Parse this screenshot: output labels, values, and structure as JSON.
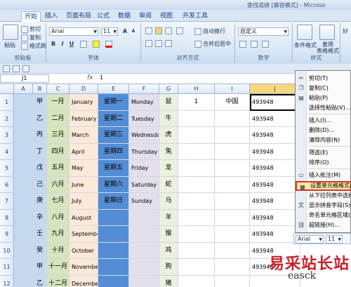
{
  "window": {
    "title": "查找成绩 [兼容模式] - Microso"
  },
  "tabs": [
    "开始",
    "插入",
    "页面布局",
    "公式",
    "数据",
    "审阅",
    "视图",
    "开发工具"
  ],
  "ribbon": {
    "clipboard": {
      "paste": "粘贴",
      "cut": "剪切",
      "copy": "复制",
      "format_painter": "格式刷",
      "label": "剪贴板"
    },
    "font": {
      "name": "Arial",
      "size": "11",
      "bold": "B",
      "italic": "I",
      "underline": "U",
      "grow": "A",
      "shrink": "A",
      "label": "字体"
    },
    "alignment": {
      "wrap": "自动换行",
      "merge": "合并后居中",
      "label": "对齐方式"
    },
    "number": {
      "format": "自定义",
      "label": "数字"
    },
    "styles": {
      "conditional": "条件格式",
      "table": "套用\n表格格式",
      "label": "样式"
    },
    "more": {
      "text": "好"
    }
  },
  "formula_bar": {
    "name_box": "J1",
    "fx": "fx",
    "value": "1"
  },
  "columns": [
    "A",
    "B",
    "C",
    "D",
    "E",
    "F",
    "G",
    "H",
    "I",
    "J"
  ],
  "rows": [
    {
      "num": "1",
      "b": "甲",
      "c": "一月",
      "d": "January",
      "e": "星期一",
      "f": "Monday",
      "g": "鼠",
      "h": "1",
      "i": "中国",
      "j": "493948"
    },
    {
      "num": "2",
      "b": "乙",
      "c": "二月",
      "d": "February",
      "e": "星期二",
      "f": "Tuesday",
      "g": "牛",
      "h": "",
      "i": "",
      "j": "493948"
    },
    {
      "num": "3",
      "b": "丙",
      "c": "三月",
      "d": "March",
      "e": "星期三",
      "f": "Wednesday",
      "g": "虎",
      "h": "",
      "i": "",
      "j": "493948"
    },
    {
      "num": "4",
      "b": "丁",
      "c": "四月",
      "d": "April",
      "e": "星期四",
      "f": "Thursday",
      "g": "兔",
      "h": "",
      "i": "",
      "j": "493948"
    },
    {
      "num": "5",
      "b": "戊",
      "c": "五月",
      "d": "May",
      "e": "星期五",
      "f": "Friday",
      "g": "龙",
      "h": "",
      "i": "",
      "j": "493948"
    },
    {
      "num": "6",
      "b": "己",
      "c": "六月",
      "d": "June",
      "e": "星期六",
      "f": "Saturday",
      "g": "蛇",
      "h": "",
      "i": "",
      "j": "493948"
    },
    {
      "num": "7",
      "b": "庚",
      "c": "七月",
      "d": "July",
      "e": "星期日",
      "f": "Sunday",
      "g": "马",
      "h": "",
      "i": "",
      "j": "493948"
    },
    {
      "num": "8",
      "b": "辛",
      "c": "八月",
      "d": "August",
      "e": "",
      "f": "",
      "g": "羊",
      "h": "",
      "i": "",
      "j": "493948"
    },
    {
      "num": "9",
      "b": "壬",
      "c": "九月",
      "d": "September",
      "e": "",
      "f": "",
      "g": "猴",
      "h": "",
      "i": "",
      "j": "493948"
    },
    {
      "num": "10",
      "b": "癸",
      "c": "十月",
      "d": "October",
      "e": "",
      "f": "",
      "g": "鸡",
      "h": "",
      "i": "",
      "j": "493948"
    },
    {
      "num": "11",
      "b": "甲",
      "c": "十一月",
      "d": "November",
      "e": "",
      "f": "",
      "g": "狗",
      "h": "",
      "i": "",
      "j": "493948"
    },
    {
      "num": "12",
      "b": "乙",
      "c": "十二月",
      "d": "December",
      "e": "",
      "f": "",
      "g": "猪",
      "h": "",
      "i": "",
      "j": ""
    }
  ],
  "context_menu": [
    {
      "label": "剪切(T)",
      "icon": "scissors-icon"
    },
    {
      "label": "复制(C)",
      "icon": "copy-icon"
    },
    {
      "label": "粘贴(P)",
      "icon": "paste-icon"
    },
    {
      "label": "选择性粘贴(V)...",
      "icon": ""
    },
    {
      "label": "插入(I)...",
      "icon": ""
    },
    {
      "label": "删除(D)...",
      "icon": ""
    },
    {
      "label": "清除内容(N)",
      "icon": ""
    },
    {
      "label": "筛选(E)",
      "icon": ""
    },
    {
      "label": "排序(O)",
      "icon": ""
    },
    {
      "label": "插入批注(M)",
      "icon": "comment-icon"
    },
    {
      "label": "设置单元格格式(F)...",
      "icon": "format-cells-icon"
    },
    {
      "label": "从下拉列表中选择(K)...",
      "icon": ""
    },
    {
      "label": "显示拼音字段(S)",
      "icon": "phonetic-icon"
    },
    {
      "label": "命名单元格区域(R)...",
      "icon": ""
    },
    {
      "label": "超链接(H)...",
      "icon": "hyperlink-icon"
    }
  ],
  "mini_toolbar": {
    "font": "Arial",
    "size": "11"
  },
  "watermark": {
    "cn": "易采站长站",
    "en": "easck"
  },
  "colors": {
    "col_b": "#c5d9f1",
    "col_c": "#d8e4bc",
    "col_d": "#fde9d9",
    "col_e": "#538dd5",
    "col_f": "#e4dfec",
    "col_g": "#ebf1de",
    "highlight": "#d03a2a"
  }
}
